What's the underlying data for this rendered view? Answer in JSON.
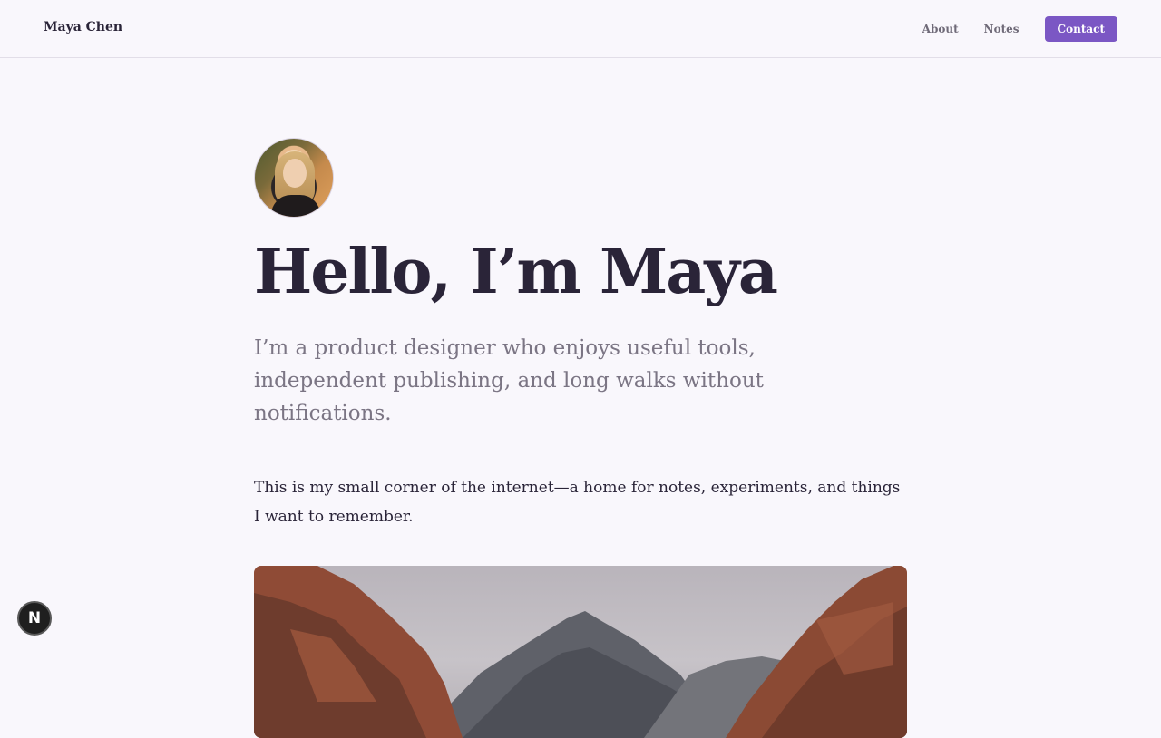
{
  "site": {
    "brand": "Maya Chen",
    "nav": [
      {
        "label": "About"
      },
      {
        "label": "Notes"
      }
    ],
    "cta_label": "Contact"
  },
  "hero": {
    "title": "Hello, I’m Maya",
    "lead": "I’m a product designer who enjoys useful tools, independent publishing, and long walks without notifications.",
    "body": "This is my small corner of the internet—a home for notes, experiments, and things I want to remember."
  },
  "badge": {
    "glyph": "N",
    "icon": "nextjs-icon"
  },
  "colors": {
    "accent": "#7b57c4",
    "text": "#2a2438",
    "muted": "#7b7584",
    "background": "#f9f7fc"
  }
}
